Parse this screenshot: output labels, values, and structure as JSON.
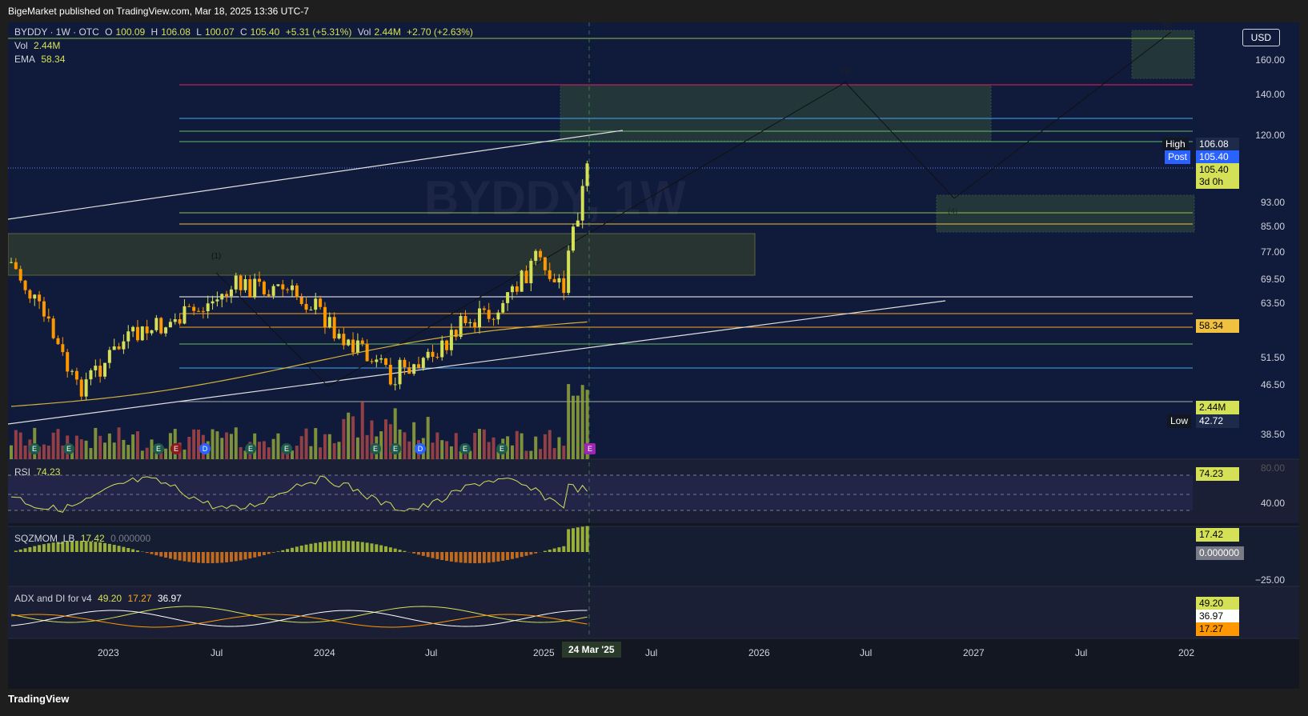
{
  "header": {
    "publisher": "BigeMarket published on TradingView.com, Mar 18, 2025 13:36 UTC-7"
  },
  "symbol": {
    "name": "BYDDY · 1W · OTC",
    "o_label": "O",
    "o": "100.09",
    "h_label": "H",
    "h": "106.08",
    "l_label": "L",
    "l": "100.07",
    "c_label": "C",
    "c": "105.40",
    "change": "+5.31 (+5.31%)",
    "vol_label": "Vol",
    "vol": "2.44M",
    "vol_change": "+2.70 (+2.63%)"
  },
  "indicators": {
    "vol_label": "Vol",
    "vol_value": "2.44M",
    "ema_label": "EMA",
    "ema_value": "58.34",
    "rsi_label": "RSI",
    "rsi_value": "74.23",
    "sqz_label": "SQZMOM_LB",
    "sqz_value": "17.42",
    "sqz_zero": "0.000000",
    "adx_label": "ADX and DI for v4",
    "adx_value": "49.20",
    "di_minus": "17.27",
    "di_plus": "36.97"
  },
  "currency": "USD",
  "price_axis": [
    "160.00",
    "140.00",
    "120.00",
    "93.00",
    "85.00",
    "77.00",
    "69.50",
    "63.50",
    "51.50",
    "46.50",
    "38.50"
  ],
  "price_tags": {
    "high_label": "High",
    "high_value": "106.08",
    "post_label": "Post",
    "post_value": "105.40",
    "last_value": "105.40",
    "countdown": "3d 0h",
    "ema_tag": "58.34",
    "vol_tag": "2.44M",
    "low_label": "Low",
    "low_value": "42.72"
  },
  "rsi_axis": [
    "80.00",
    "40.00"
  ],
  "sqz_axis": [
    "−25.00"
  ],
  "time_axis": [
    "2023",
    "Jul",
    "2024",
    "Jul",
    "2025",
    "Jul",
    "2026",
    "Jul",
    "2027",
    "Jul",
    "202"
  ],
  "time_cursor": "24 Mar '25",
  "wave_labels": [
    "(1)",
    "(3)",
    "(4)",
    "(5)"
  ],
  "watermark": "BYDDY, 1W",
  "footer": "TradingView",
  "colors": {
    "bg": "#131722",
    "up": "#d4e157",
    "down": "#ff9800",
    "ema": "#d4b23a",
    "rsi": "#d4e157"
  }
}
